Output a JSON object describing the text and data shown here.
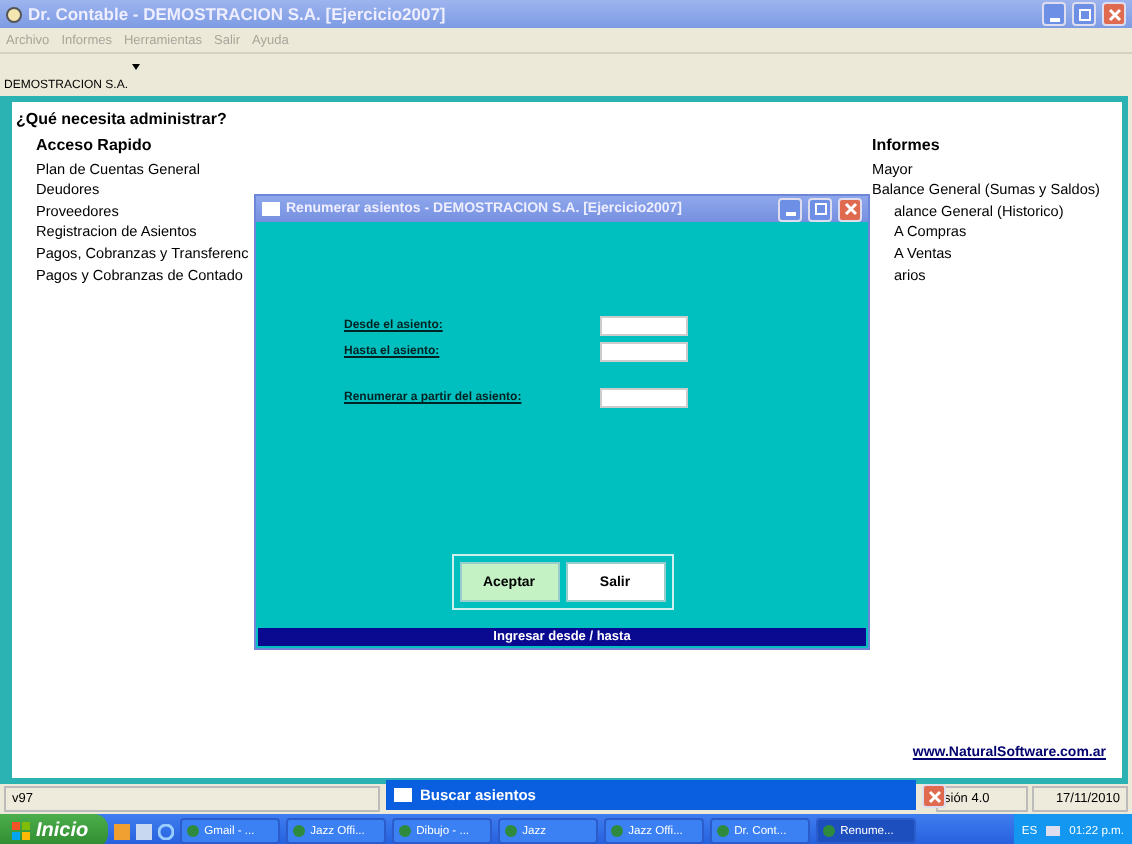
{
  "window": {
    "title": "Dr. Contable - DEMOSTRACION S.A.  [Ejercicio2007]"
  },
  "menu": [
    {
      "label": "Archivo",
      "disabled": true
    },
    {
      "label": "Informes",
      "disabled": true
    },
    {
      "label": "Herramientas",
      "disabled": true
    },
    {
      "label": "Salir",
      "disabled": true
    },
    {
      "label": "Ayuda",
      "disabled": true
    }
  ],
  "company_selector": {
    "value": "DEMOSTRACION S.A."
  },
  "heading": "¿Qué necesita administrar?",
  "quick_access": {
    "title": "Acceso Rapido",
    "items": [
      "Plan de Cuentas General",
      "Deudores",
      "Proveedores",
      "Registracion de Asientos",
      "Pagos, Cobranzas y Transferenc",
      "Pagos y Cobranzas de Contado"
    ]
  },
  "reports": {
    "title": "Informes",
    "items": [
      {
        "label": "Mayor",
        "covered": false
      },
      {
        "label": "Balance General (Sumas y Saldos)",
        "covered": false
      },
      {
        "label": "alance General (Historico)",
        "covered": true
      },
      {
        "label": "A Compras",
        "covered": true
      },
      {
        "label": "A Ventas",
        "covered": true
      },
      {
        "label": "arios",
        "covered": true
      }
    ]
  },
  "link": "www.NaturalSoftware.com.ar",
  "dialog": {
    "title": "Renumerar asientos - DEMOSTRACION S.A.  [Ejercicio2007]",
    "fields": [
      {
        "label": "Desde el asiento:",
        "kind": "range"
      },
      {
        "label": "Hasta el asiento:",
        "kind": "range"
      },
      {
        "label": "Renumerar a partir del asiento:",
        "kind": "target"
      }
    ],
    "buttons": [
      {
        "label": "Aceptar",
        "selected": true
      },
      {
        "label": "Salir",
        "selected": false
      }
    ],
    "status": "Ingresar desde / hasta"
  },
  "status_bar": {
    "version": "v97",
    "version_2": "sión 4.0",
    "date": "17/11/2010"
  },
  "background_window": {
    "title": "Buscar asientos"
  },
  "taskbar": {
    "start": "Inicio",
    "buttons": [
      {
        "label": "Gmail - ...",
        "selected": false
      },
      {
        "label": "Jazz Offi...",
        "selected": false
      },
      {
        "label": "Dibujo - ...",
        "selected": false
      },
      {
        "label": "Jazz",
        "selected": false
      },
      {
        "label": "Jazz Offi...",
        "selected": false
      },
      {
        "label": "Dr. Cont...",
        "selected": false
      },
      {
        "label": "Renume...",
        "selected": true
      }
    ],
    "language": "ES",
    "clock": "01:22 p.m."
  }
}
